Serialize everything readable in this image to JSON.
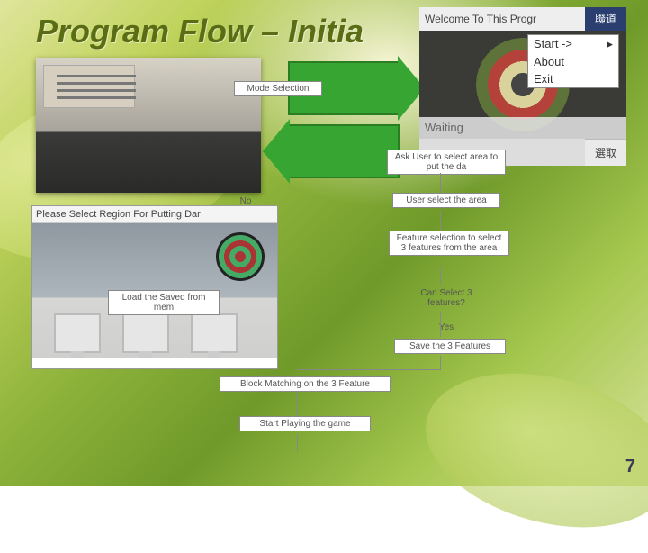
{
  "title": "Program Flow – Initia",
  "flow": {
    "mode_selection": "Mode Selection",
    "no": "No",
    "ask_select_area": "Ask User to select area to put the da",
    "user_select_area": "User select the area",
    "feature_selection": "Feature selection to select 3 features from the area",
    "can_select": "Can Select 3 features?",
    "yes": "Yes",
    "save_features": "Save the 3 Features",
    "load_saved": "Load the Saved from mem",
    "block_match": "Block Matching on the 3 Feature",
    "start_play": "Start Playing the game"
  },
  "photo2_title": "Please Select Region For Putting Dar",
  "phone": {
    "welcome": "Welcome To This Progr",
    "top_btn": "聯道",
    "waiting": "Waiting",
    "bottom_btn": "選取",
    "menu": {
      "start": "Start ->",
      "about": "About",
      "exit": "Exit"
    }
  },
  "page": "7"
}
